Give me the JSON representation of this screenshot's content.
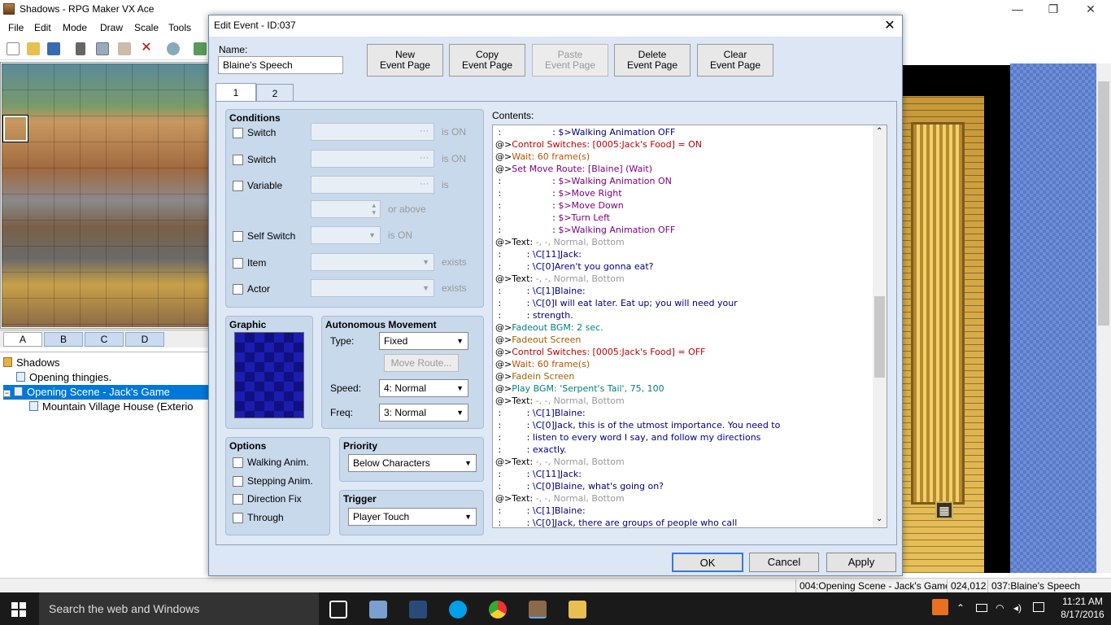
{
  "app": {
    "title": "Shadows - RPG Maker VX Ace",
    "menu": [
      "File",
      "Edit",
      "Mode",
      "Draw",
      "Scale",
      "Tools"
    ],
    "tile_tabs": [
      "A",
      "B",
      "C",
      "D"
    ],
    "tree": {
      "root": "Shadows",
      "items": [
        {
          "label": "Opening thingies."
        },
        {
          "label": "Opening Scene - Jack's Game"
        },
        {
          "label": "Mountain Village House (Exterio"
        }
      ]
    },
    "status": {
      "map": "004:Opening Scene - Jack's Game (",
      "coords": "024,012",
      "event": "037:Blaine's Speech"
    }
  },
  "window_controls": {
    "minimize": "—",
    "restore": "❐",
    "close": "✕"
  },
  "dialog": {
    "title": "Edit Event - ID:037",
    "close": "✕",
    "name_label": "Name:",
    "name_value": "Blaine's Speech",
    "buttons": {
      "new": [
        "New",
        "Event Page"
      ],
      "copy": [
        "Copy",
        "Event Page"
      ],
      "paste": [
        "Paste",
        "Event Page"
      ],
      "delete": [
        "Delete",
        "Event Page"
      ],
      "clear": [
        "Clear",
        "Event Page"
      ]
    },
    "page_tabs": [
      "1",
      "2"
    ],
    "conditions": {
      "title": "Conditions",
      "switch1": "Switch",
      "switch2": "Switch",
      "variable": "Variable",
      "self_switch": "Self Switch",
      "item": "Item",
      "actor": "Actor",
      "is_on": "is ON",
      "is": "is",
      "or_above": "or above",
      "exists": "exists"
    },
    "graphic_title": "Graphic",
    "movement": {
      "title": "Autonomous Movement",
      "type_label": "Type:",
      "type_value": "Fixed",
      "route_button": "Move Route...",
      "speed_label": "Speed:",
      "speed_value": "4: Normal",
      "freq_label": "Freq:",
      "freq_value": "3: Normal"
    },
    "options": {
      "title": "Options",
      "walking": "Walking Anim.",
      "stepping": "Stepping Anim.",
      "direction": "Direction Fix",
      "through": "Through"
    },
    "priority": {
      "title": "Priority",
      "value": "Below Characters"
    },
    "trigger": {
      "title": "Trigger",
      "value": "Player Touch"
    },
    "contents_label": "Contents:",
    "contents": [
      {
        "p": " :                  : ",
        "t": "$>Walking Animation OFF",
        "c": "#000080"
      },
      {
        "p": "@>",
        "t": "Control Switches: [0005:Jack's Food] = ON",
        "c": "#c00000"
      },
      {
        "p": "@>",
        "t": "Wait: 60 frame(s)",
        "c": "#c05000"
      },
      {
        "p": "@>",
        "t": "Set Move Route: [Blaine] (Wait)",
        "c": "#800080"
      },
      {
        "p": " :                  : ",
        "t": "$>Walking Animation ON",
        "c": "#800080"
      },
      {
        "p": " :                  : ",
        "t": "$>Move Right",
        "c": "#800080"
      },
      {
        "p": " :                  : ",
        "t": "$>Move Down",
        "c": "#800080"
      },
      {
        "p": " :                  : ",
        "t": "$>Turn Left",
        "c": "#800080"
      },
      {
        "p": " :                  : ",
        "t": "$>Walking Animation OFF",
        "c": "#800080"
      },
      {
        "p": "@>Text: ",
        "t": "-, -, Normal, Bottom",
        "c": "#999999"
      },
      {
        "p": " :         : ",
        "t": "\\C[11]Jack:",
        "c": "#000080"
      },
      {
        "p": " :         : ",
        "t": "\\C[0]Aren't you gonna eat?",
        "c": "#000080"
      },
      {
        "p": "@>Text: ",
        "t": "-, -, Normal, Bottom",
        "c": "#999999"
      },
      {
        "p": " :         : ",
        "t": "\\C[1]Blaine:",
        "c": "#000080"
      },
      {
        "p": " :         : ",
        "t": "\\C[0]I will eat later. Eat up; you will need your",
        "c": "#000080"
      },
      {
        "p": " :         : ",
        "t": "strength.",
        "c": "#000080"
      },
      {
        "p": "@>",
        "t": "Fadeout BGM: 2 sec.",
        "c": "#008080"
      },
      {
        "p": "@>",
        "t": "Fadeout Screen",
        "c": "#a06000"
      },
      {
        "p": "@>",
        "t": "Control Switches: [0005:Jack's Food] = OFF",
        "c": "#c00000"
      },
      {
        "p": "@>",
        "t": "Wait: 60 frame(s)",
        "c": "#c05000"
      },
      {
        "p": "@>",
        "t": "Fadein Screen",
        "c": "#a06000"
      },
      {
        "p": "@>",
        "t": "Play BGM: 'Serpent's Tail', 75, 100",
        "c": "#008080"
      },
      {
        "p": "@>Text: ",
        "t": "-, -, Normal, Bottom",
        "c": "#999999"
      },
      {
        "p": " :         : ",
        "t": "\\C[1]Blaine:",
        "c": "#000080"
      },
      {
        "p": " :         : ",
        "t": "\\C[0]Jack, this is of the utmost importance. You need to",
        "c": "#000080"
      },
      {
        "p": " :         : ",
        "t": "listen to every word I say, and follow my directions",
        "c": "#000080"
      },
      {
        "p": " :         : ",
        "t": "exactly.",
        "c": "#000080"
      },
      {
        "p": "@>Text: ",
        "t": "-, -, Normal, Bottom",
        "c": "#999999"
      },
      {
        "p": " :         : ",
        "t": "\\C[11]Jack:",
        "c": "#000080"
      },
      {
        "p": " :         : ",
        "t": "\\C[0]Blaine, what's going on?",
        "c": "#000080"
      },
      {
        "p": "@>Text: ",
        "t": "-, -, Normal, Bottom",
        "c": "#999999"
      },
      {
        "p": " :         : ",
        "t": "\\C[1]Blaine:",
        "c": "#000080"
      },
      {
        "p": " :         : ",
        "t": "\\C[0]Jack, there are groups of people who call",
        "c": "#000080"
      }
    ],
    "ok": "OK",
    "cancel": "Cancel",
    "apply": "Apply"
  },
  "taskbar": {
    "search": "Search the web and Windows",
    "time": "11:21 AM",
    "date": "8/17/2016"
  }
}
